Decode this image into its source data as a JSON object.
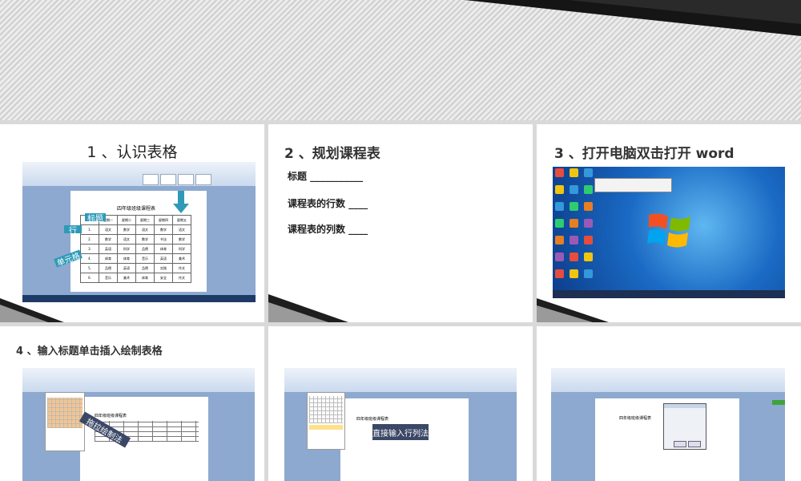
{
  "slides": [
    {
      "title": "1 、认识表格",
      "doc_title": "四年级班级课程表",
      "labels": {
        "title_label": "标题",
        "row_label": "行",
        "cell_label": "单元格"
      },
      "row_numbers": [
        "1.",
        "2.",
        "3.",
        "4.",
        "5.",
        "6."
      ],
      "table_header": [
        "",
        "星期一",
        "星期二",
        "星期三",
        "星期四",
        "星期五"
      ],
      "table_rows": [
        [
          "1.",
          "语文",
          "数学",
          "语文",
          "数学",
          "语文"
        ],
        [
          "2.",
          "数学",
          "语文",
          "数学",
          "书法",
          "数学"
        ],
        [
          "3.",
          "英语",
          "科学",
          "品德",
          "体育",
          "科学"
        ],
        [
          "4.",
          "体育",
          "体育",
          "音乐",
          "英语",
          "美术"
        ],
        [
          "5.",
          "品德",
          "英语",
          "品德",
          "实践",
          "作文"
        ],
        [
          "6.",
          "音乐",
          "美术",
          "体育",
          "安全",
          "作文"
        ]
      ]
    },
    {
      "title": "2 、规划课程表",
      "lines": [
        "标题 ___________",
        "课程表的行数 ____",
        "课程表的列数 ____"
      ]
    },
    {
      "title": "3 、打开电脑双击打开 word"
    },
    {
      "title": "4 、输入标题单击插入绘制表格",
      "doc_text": "四年级班级课程表",
      "callout": "拖拉绘制法"
    },
    {
      "callout": "直接输入行列法",
      "doc_text": "四年级班级课程表"
    },
    {
      "doc_text": "四年级班级课程表"
    }
  ],
  "colors": {
    "accent": "#2e9ab8",
    "dark_arrow": "#3b4766",
    "banner_dark": "#1b1b1b"
  }
}
